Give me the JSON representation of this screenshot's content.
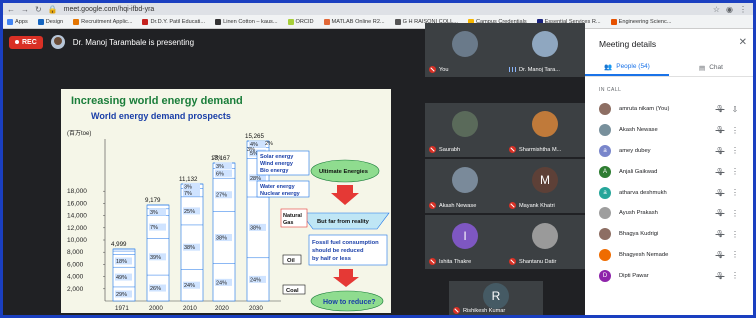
{
  "browser": {
    "url": "meet.google.com/hqi-ifbd-yra",
    "bookmarks": [
      {
        "label": "Apps",
        "color": "#4285f4"
      },
      {
        "label": "Design",
        "color": "#1565c0"
      },
      {
        "label": "Recruitment Applic...",
        "color": "#e37400"
      },
      {
        "label": "Dr.D.Y. Patil Educati...",
        "color": "#c5221f"
      },
      {
        "label": "Linen Cotton – kaus...",
        "color": "#333333"
      },
      {
        "label": "ORCID",
        "color": "#a6ce39"
      },
      {
        "label": "MATLAB Online R2...",
        "color": "#e16737"
      },
      {
        "label": "G H RAISONI COLL...",
        "color": "#555555"
      },
      {
        "label": "Campus Credentials",
        "color": "#f4b400"
      },
      {
        "label": "Essential Services R...",
        "color": "#1a237e"
      },
      {
        "label": "Engineering Scienc...",
        "color": "#e65100"
      }
    ]
  },
  "meeting": {
    "rec_label": "REC",
    "presenting_text": "Dr. Manoj Tarambale is presenting"
  },
  "slide": {
    "title": "Increasing world energy demand",
    "subtitle": "World energy demand prospects",
    "unit_label": "(百万toe)",
    "yticks": [
      "18,000",
      "16,000",
      "14,000",
      "12,000",
      "10,000",
      "8,000",
      "6,000",
      "4,000",
      "2,000"
    ],
    "xticks": [
      "1971",
      "2000",
      "2010",
      "2020",
      "2030"
    ],
    "totals": [
      "4,999",
      "9,179",
      "11,132",
      "13,167",
      "15,265"
    ],
    "bars": [
      {
        "coal": "29%",
        "oil": "49%",
        "gas": "18%",
        "nuclear": "",
        "renew": ""
      },
      {
        "coal": "26%",
        "oil": "39%",
        "gas": "7%",
        "nuclear": "3%",
        "renew": ""
      },
      {
        "coal": "24%",
        "oil": "38%",
        "gas": "25%",
        "nuclear": "7%",
        "renew": "3%"
      },
      {
        "coal": "24%",
        "oil": "38%",
        "gas": "27%",
        "nuclear": "6%",
        "renew": "3%"
      },
      {
        "coal": "24%",
        "oil": "38%",
        "gas": "28%",
        "nuclear": "5%",
        "renew": "4%"
      }
    ],
    "extra_top": [
      "3%",
      "3%",
      "2%"
    ],
    "legend_box": [
      "Solar energy",
      "Wind energy",
      "Bio energy"
    ],
    "water_box": [
      "Water energy",
      "Nuclear energy"
    ],
    "ultimate": "Ultimate Energies",
    "far_from": "But far from reality",
    "natural_gas": [
      "Natural",
      "Gas"
    ],
    "oil_label": "Oil",
    "coal_label": "Coal",
    "fossil_box": [
      "Fossil fuel consumption",
      "should be reduced",
      "by half or less"
    ],
    "how": "How to reduce?"
  },
  "tiles": [
    {
      "name": "You",
      "initial": "",
      "color": "#6a7a8a",
      "mic": "muted"
    },
    {
      "name": "Dr. Manoj Tara...",
      "initial": "",
      "color": "#8fa7c0",
      "mic": "on"
    },
    {
      "name": "Saurabh",
      "initial": "",
      "color": "#5a6a5a",
      "mic": "muted"
    },
    {
      "name": "Sharmishtha M...",
      "initial": "",
      "color": "#c07a3a",
      "mic": "muted"
    },
    {
      "name": "Akash Newase",
      "initial": "",
      "color": "#7a8a9a",
      "mic": "muted"
    },
    {
      "name": "Mayank Khatri",
      "initial": "M",
      "color": "#5d4037",
      "mic": "muted"
    },
    {
      "name": "Ishita Thakre",
      "initial": "I",
      "color": "#7e57c2",
      "mic": "muted"
    },
    {
      "name": "Shantanu Datir",
      "initial": "",
      "color": "#9a9a9a",
      "mic": "muted"
    },
    {
      "name": "Rishikesh Kumar",
      "initial": "R",
      "color": "#455a64",
      "mic": "muted"
    }
  ],
  "panel": {
    "title": "Meeting details",
    "people_tab": "People (54)",
    "chat_tab": "Chat",
    "in_call": "IN CALL",
    "people": [
      {
        "name": "amruta nikam (You)",
        "initial": "",
        "color": "#8d6e63"
      },
      {
        "name": "Akash Newase",
        "initial": "",
        "color": "#78909c"
      },
      {
        "name": "amey dubey",
        "initial": "a",
        "color": "#7986cb"
      },
      {
        "name": "Anjali Gaikwad",
        "initial": "A",
        "color": "#2e7d32"
      },
      {
        "name": "atharva deshmukh",
        "initial": "a",
        "color": "#26a69a"
      },
      {
        "name": "Ayush Prakash",
        "initial": "",
        "color": "#9e9e9e"
      },
      {
        "name": "Bhagya Kudrigi",
        "initial": "",
        "color": "#8d6e63"
      },
      {
        "name": "Bhagyesh Nemade",
        "initial": "",
        "color": "#ef6c00"
      },
      {
        "name": "Dipti Pawar",
        "initial": "D",
        "color": "#8e24aa"
      }
    ]
  }
}
